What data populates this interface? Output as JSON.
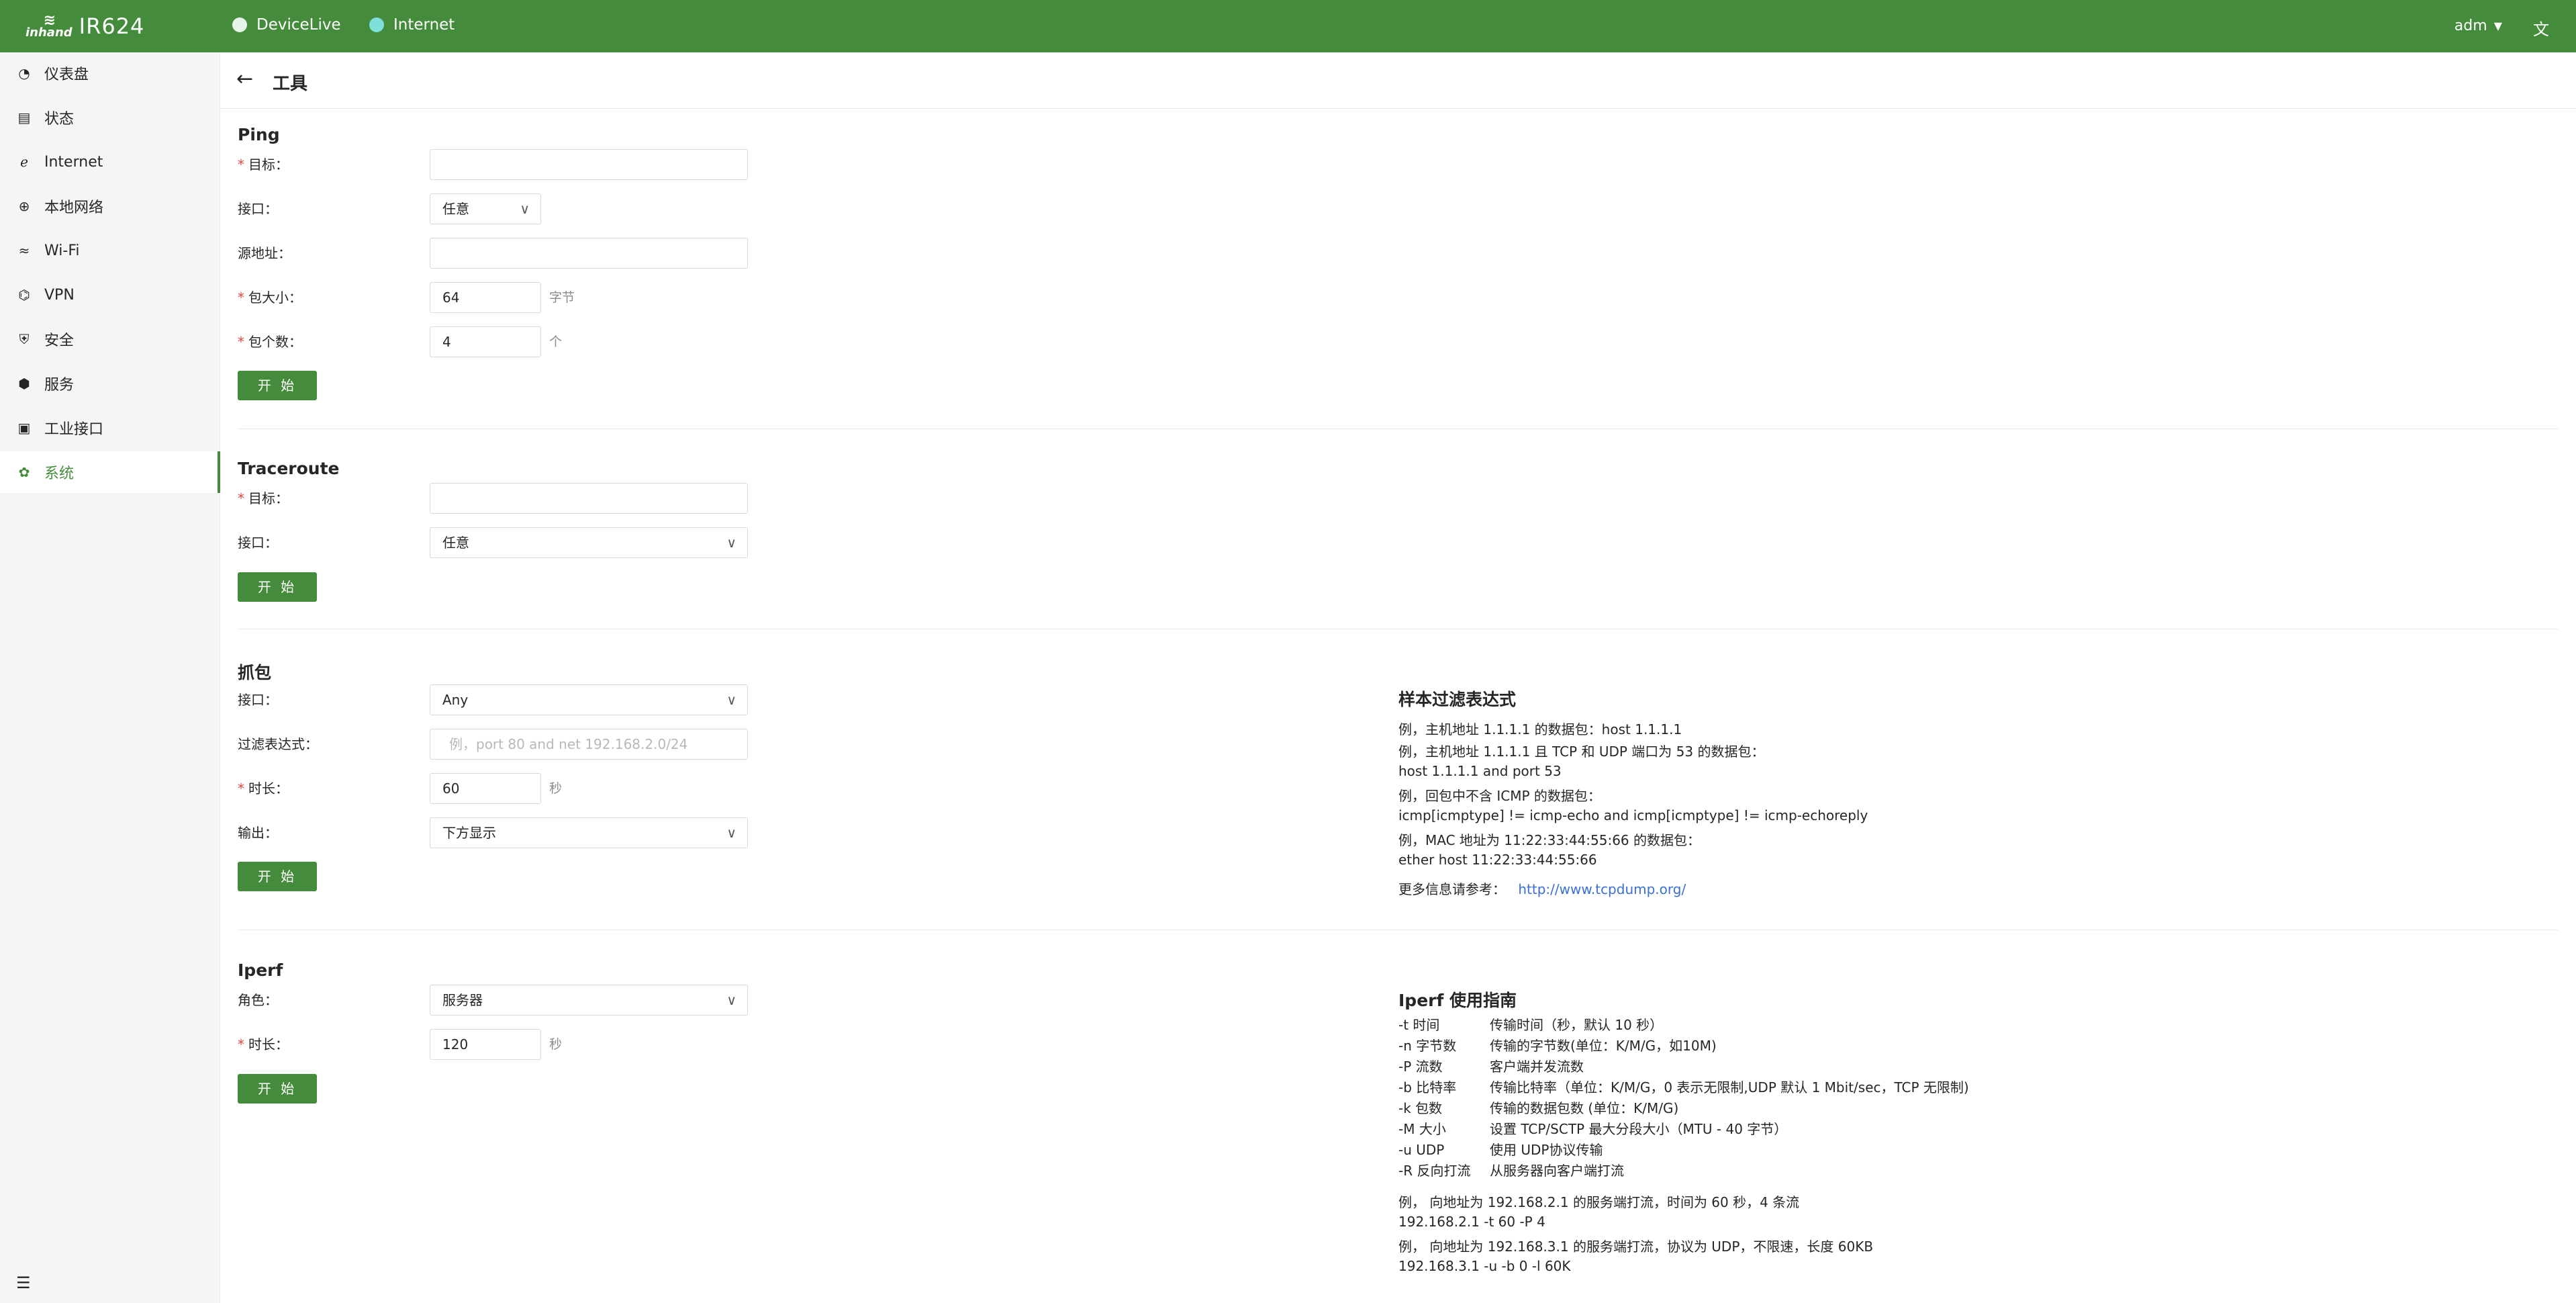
{
  "brand": {
    "logo_mark_top": "≋",
    "logo_mark_bottom": "inhand",
    "product": "IR624"
  },
  "topbar": {
    "status": [
      {
        "label": "DeviceLive",
        "color": "#e6f4ea"
      },
      {
        "label": "Internet",
        "color": "#7ee0d8"
      }
    ],
    "user": "adm",
    "lang_icon": "translate-icon"
  },
  "sidebar": {
    "items": [
      {
        "label": "仪表盘",
        "icon": "dashboard-icon"
      },
      {
        "label": "状态",
        "icon": "status-icon"
      },
      {
        "label": "Internet",
        "icon": "internet-icon"
      },
      {
        "label": "本地网络",
        "icon": "globe-icon"
      },
      {
        "label": "Wi-Fi",
        "icon": "wifi-icon"
      },
      {
        "label": "VPN",
        "icon": "vpn-icon"
      },
      {
        "label": "安全",
        "icon": "shield-icon"
      },
      {
        "label": "服务",
        "icon": "services-icon"
      },
      {
        "label": "工业接口",
        "icon": "industrial-icon"
      },
      {
        "label": "系统",
        "icon": "gear-icon"
      }
    ],
    "active_index": 9
  },
  "page": {
    "title": "工具"
  },
  "ping": {
    "title": "Ping",
    "target_label": "目标",
    "target_value": "",
    "interface_label": "接口",
    "interface_value": "任意",
    "source_label": "源地址",
    "source_value": "",
    "size_label": "包大小",
    "size_value": "64",
    "size_unit": "字节",
    "count_label": "包个数",
    "count_value": "4",
    "count_unit": "个",
    "start": "开 始"
  },
  "traceroute": {
    "title": "Traceroute",
    "target_label": "目标",
    "target_value": "",
    "interface_label": "接口",
    "interface_value": "任意",
    "start": "开 始"
  },
  "capture": {
    "title": "抓包",
    "interface_label": "接口",
    "interface_value": "Any",
    "filter_label": "过滤表达式",
    "filter_placeholder": "例，port 80 and net 192.168.2.0/24",
    "duration_label": "时长",
    "duration_value": "60",
    "duration_unit": "秒",
    "output_label": "输出",
    "output_value": "下方显示",
    "start": "开 始",
    "help_title": "样本过滤表达式",
    "help_lines": [
      "例，主机地址 1.1.1.1 的数据包：host 1.1.1.1",
      "例，主机地址 1.1.1.1 且 TCP 和 UDP 端口为 53 的数据包：",
      "host 1.1.1.1 and port 53",
      "例，回包中不含 ICMP 的数据包：",
      "icmp[icmptype] != icmp-echo and icmp[icmptype] != icmp-echoreply",
      "例，MAC 地址为 11:22:33:44:55:66 的数据包：",
      "ether host 11:22:33:44:55:66"
    ],
    "more_label": "更多信息请参考：",
    "more_link": "http://www.tcpdump.org/"
  },
  "iperf": {
    "title": "Iperf",
    "role_label": "角色",
    "role_value": "服务器",
    "duration_label": "时长",
    "duration_value": "120",
    "duration_unit": "秒",
    "start": "开 始",
    "help_title": "Iperf 使用指南",
    "options": [
      {
        "flag": "-t   时间",
        "desc": "传输时间（秒，默认 10 秒）"
      },
      {
        "flag": "-n   字节数",
        "desc": "传输的字节数(单位：K/M/G，如10M)"
      },
      {
        "flag": "-P   流数",
        "desc": "客户端并发流数"
      },
      {
        "flag": "-b   比特率",
        "desc": "传输比特率（单位：K/M/G，0 表示无限制,UDP 默认 1 Mbit/sec，TCP 无限制)"
      },
      {
        "flag": "-k   包数",
        "desc": "传输的数据包数 (单位：K/M/G)"
      },
      {
        "flag": "-M  大小",
        "desc": "设置 TCP/SCTP 最大分段大小（MTU - 40 字节）"
      },
      {
        "flag": "-u   UDP",
        "desc": "使用 UDP协议传输"
      },
      {
        "flag": "-R   反向打流",
        "desc": "从服务器向客户端打流"
      }
    ],
    "examples": [
      "例， 向地址为 192.168.2.1 的服务端打流，时间为 60 秒，4 条流",
      "192.168.2.1 -t 60 -P 4",
      "例， 向地址为 192.168.3.1 的服务端打流，协议为 UDP，不限速，长度 60KB",
      "192.168.3.1 -u -b 0 -l 60K"
    ]
  }
}
